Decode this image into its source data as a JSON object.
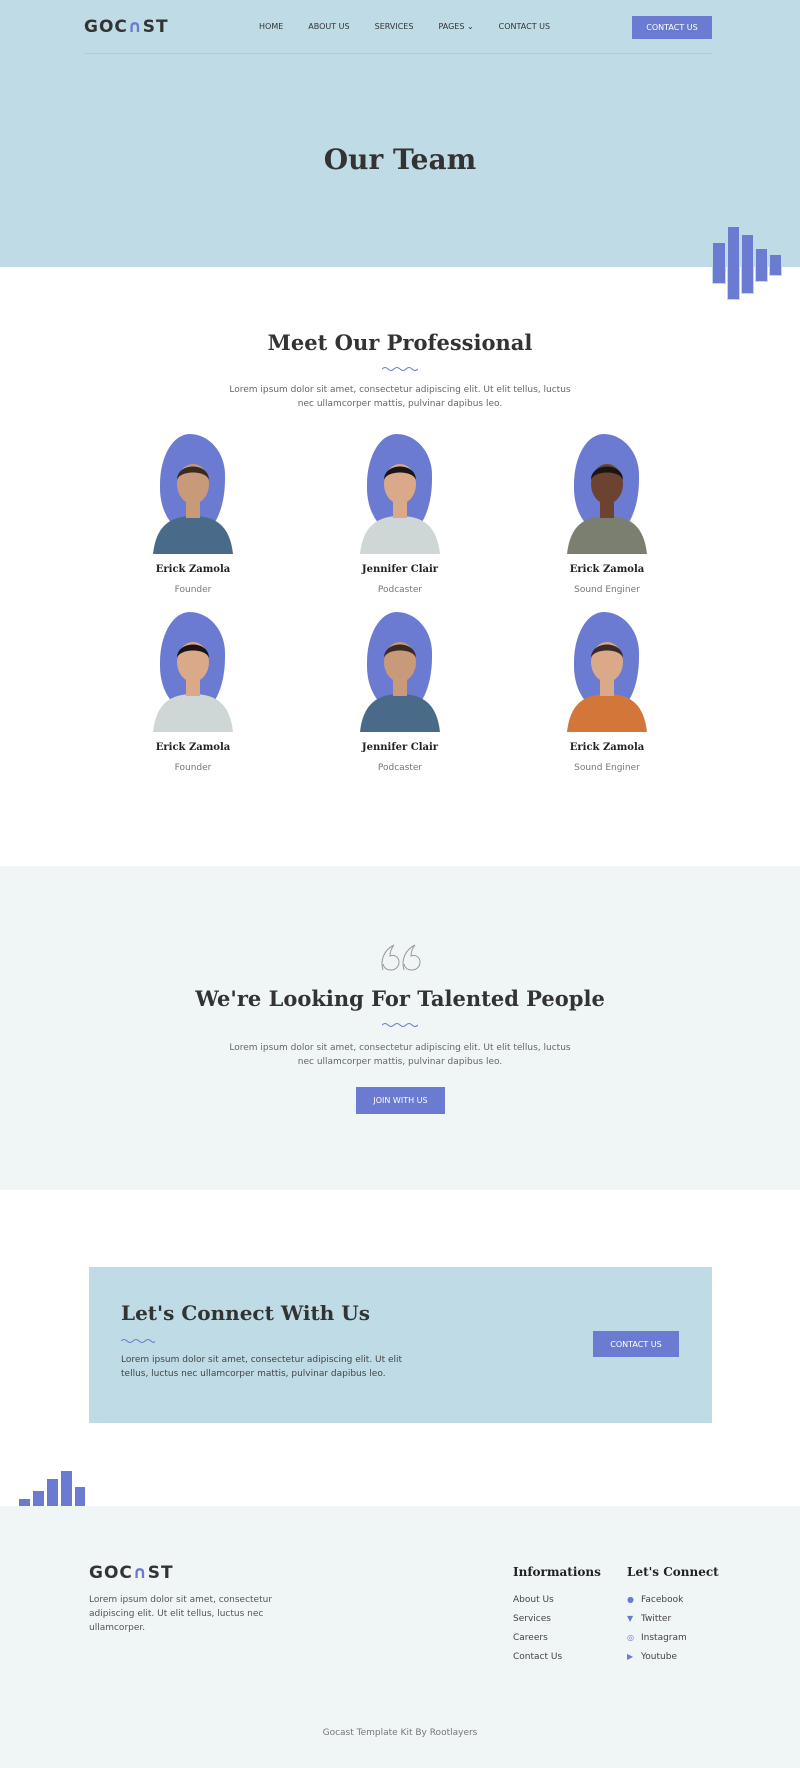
{
  "brand": {
    "logo": "GOCAST",
    "accent": "#6b7bd1",
    "hero_bg": "#bfdbe5",
    "soft_bg": "#f0f5f6"
  },
  "nav": {
    "items": [
      "HOME",
      "ABOUT US",
      "SERVICES",
      "PAGES",
      "CONTACT US"
    ],
    "cta": "CONTACT US"
  },
  "hero": {
    "title": "Our Team"
  },
  "team": {
    "title": "Meet Our Professional",
    "text_line1": "Lorem ipsum dolor sit amet, consectetur adipiscing elit. Ut elit tellus, luctus",
    "text_line2": "nec ullamcorper mattis, pulvinar dapibus leo.",
    "members": [
      {
        "name": "Erick Zamola",
        "role": "Founder",
        "shirt": "#4a6a8a",
        "skin": "#c99a7a",
        "hair": "#3a2a20"
      },
      {
        "name": "Jennifer Clair",
        "role": "Podcaster",
        "shirt": "#cfd6d6",
        "skin": "#d9a98a",
        "hair": "#1a1412"
      },
      {
        "name": "Erick Zamola",
        "role": "Sound Enginer",
        "shirt": "#7b7f70",
        "skin": "#6b4330",
        "hair": "#1a1412"
      },
      {
        "name": "Erick Zamola",
        "role": "Founder",
        "shirt": "#cfd6d6",
        "skin": "#d9a98a",
        "hair": "#1a1412"
      },
      {
        "name": "Jennifer Clair",
        "role": "Podcaster",
        "shirt": "#4a6a8a",
        "skin": "#c99a7a",
        "hair": "#3a2a20"
      },
      {
        "name": "Erick Zamola",
        "role": "Sound Enginer",
        "shirt": "#d2763a",
        "skin": "#d9a98a",
        "hair": "#3a2a20"
      }
    ]
  },
  "talent": {
    "title": "We're Looking For Talented People",
    "text_line1": "Lorem ipsum dolor sit amet, consectetur adipiscing elit. Ut elit tellus, luctus",
    "text_line2": "nec ullamcorper mattis, pulvinar dapibus leo.",
    "button": "JOIN WITH US"
  },
  "connect": {
    "title": "Let's Connect With Us",
    "text_line1": "Lorem ipsum dolor sit amet, consectetur adipiscing elit. Ut elit",
    "text_line2": "tellus, luctus nec ullamcorper mattis, pulvinar dapibus leo.",
    "button": "CONTACT US"
  },
  "footer": {
    "logo": "GOCAST",
    "about_line1": "Lorem ipsum dolor sit amet, consectetur",
    "about_line2": "adipiscing elit. Ut elit tellus, luctus nec",
    "about_line3": "ullamcorper.",
    "info_title": "Informations",
    "info_links": [
      "About Us",
      "Services",
      "Careers",
      "Contact Us"
    ],
    "connect_title": "Let's Connect",
    "social": [
      {
        "label": "Facebook",
        "icon": "facebook-icon"
      },
      {
        "label": "Twitter",
        "icon": "twitter-icon"
      },
      {
        "label": "Instagram",
        "icon": "instagram-icon"
      },
      {
        "label": "Youtube",
        "icon": "youtube-icon"
      }
    ],
    "credit": "Gocast Template Kit By Rootlayers"
  }
}
